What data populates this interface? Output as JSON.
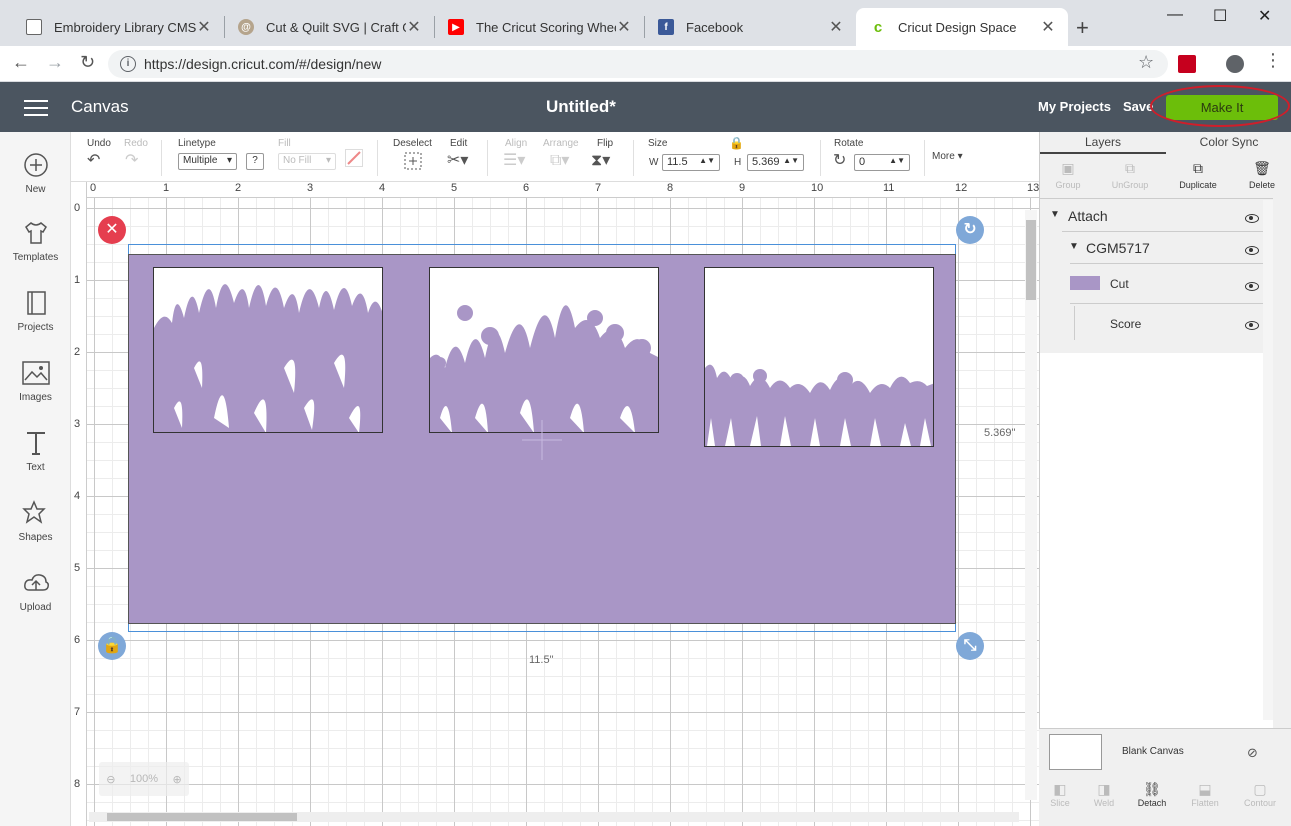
{
  "browser": {
    "tabs": [
      {
        "title": "Embroidery Library CMS",
        "icon": "document-icon"
      },
      {
        "title": "Cut & Quilt SVG | Craft Gen",
        "icon": "spiral-icon"
      },
      {
        "title": "The Cricut Scoring Wheel vs",
        "icon": "youtube-icon"
      },
      {
        "title": "Facebook",
        "icon": "facebook-icon"
      },
      {
        "title": "Cricut Design Space",
        "icon": "cricut-icon"
      }
    ],
    "url": "https://design.cricut.com/#/design/new"
  },
  "header": {
    "app_title": "Canvas",
    "doc_title": "Untitled*",
    "my_projects": "My Projects",
    "save": "Save",
    "make_it": "Make It"
  },
  "sidebar": [
    {
      "label": "New",
      "icon": "plus-circle-icon"
    },
    {
      "label": "Templates",
      "icon": "shirt-icon"
    },
    {
      "label": "Projects",
      "icon": "book-icon"
    },
    {
      "label": "Images",
      "icon": "image-icon"
    },
    {
      "label": "Text",
      "icon": "text-icon"
    },
    {
      "label": "Shapes",
      "icon": "shapes-icon"
    },
    {
      "label": "Upload",
      "icon": "cloud-upload-icon"
    }
  ],
  "toolbar": {
    "undo": "Undo",
    "redo": "Redo",
    "linetype_label": "Linetype",
    "linetype_value": "Multiple",
    "help": "?",
    "fill_label": "Fill",
    "fill_value": "No Fill",
    "deselect": "Deselect",
    "edit": "Edit",
    "align": "Align",
    "arrange": "Arrange",
    "flip": "Flip",
    "size_label": "Size",
    "w_label": "W",
    "w_value": "11.5",
    "h_label": "H",
    "h_value": "5.369",
    "rotate_label": "Rotate",
    "rotate_value": "0",
    "more": "More"
  },
  "canvas": {
    "ruler_h": [
      "0",
      "1",
      "2",
      "3",
      "4",
      "5",
      "6",
      "7",
      "8",
      "9",
      "10",
      "11",
      "12",
      "13"
    ],
    "ruler_v": [
      "0",
      "1",
      "2",
      "3",
      "4",
      "5",
      "6",
      "7",
      "8"
    ],
    "width_readout": "11.5\"",
    "height_readout": "5.369\"",
    "zoom": "100%"
  },
  "layers": {
    "tabs": [
      "Layers",
      "Color Sync"
    ],
    "actions": [
      {
        "label": "Group",
        "enabled": false
      },
      {
        "label": "UnGroup",
        "enabled": false
      },
      {
        "label": "Duplicate",
        "enabled": true
      },
      {
        "label": "Delete",
        "enabled": true
      }
    ],
    "tree": [
      {
        "label": "Attach"
      },
      {
        "label": "CGM5717"
      },
      {
        "label": "Cut"
      },
      {
        "label": "Score"
      }
    ],
    "cut_swatch_color": "#a996c6",
    "blank_canvas": "Blank Canvas",
    "bottom_actions": [
      {
        "label": "Slice",
        "enabled": false
      },
      {
        "label": "Weld",
        "enabled": false
      },
      {
        "label": "Detach",
        "enabled": true
      },
      {
        "label": "Flatten",
        "enabled": false
      },
      {
        "label": "Contour",
        "enabled": false
      }
    ]
  },
  "colors": {
    "header_bg": "#4b5560",
    "make_it_green": "#6cbe0a",
    "material_purple": "#a996c6",
    "annotation_red": "#d01e2a"
  }
}
